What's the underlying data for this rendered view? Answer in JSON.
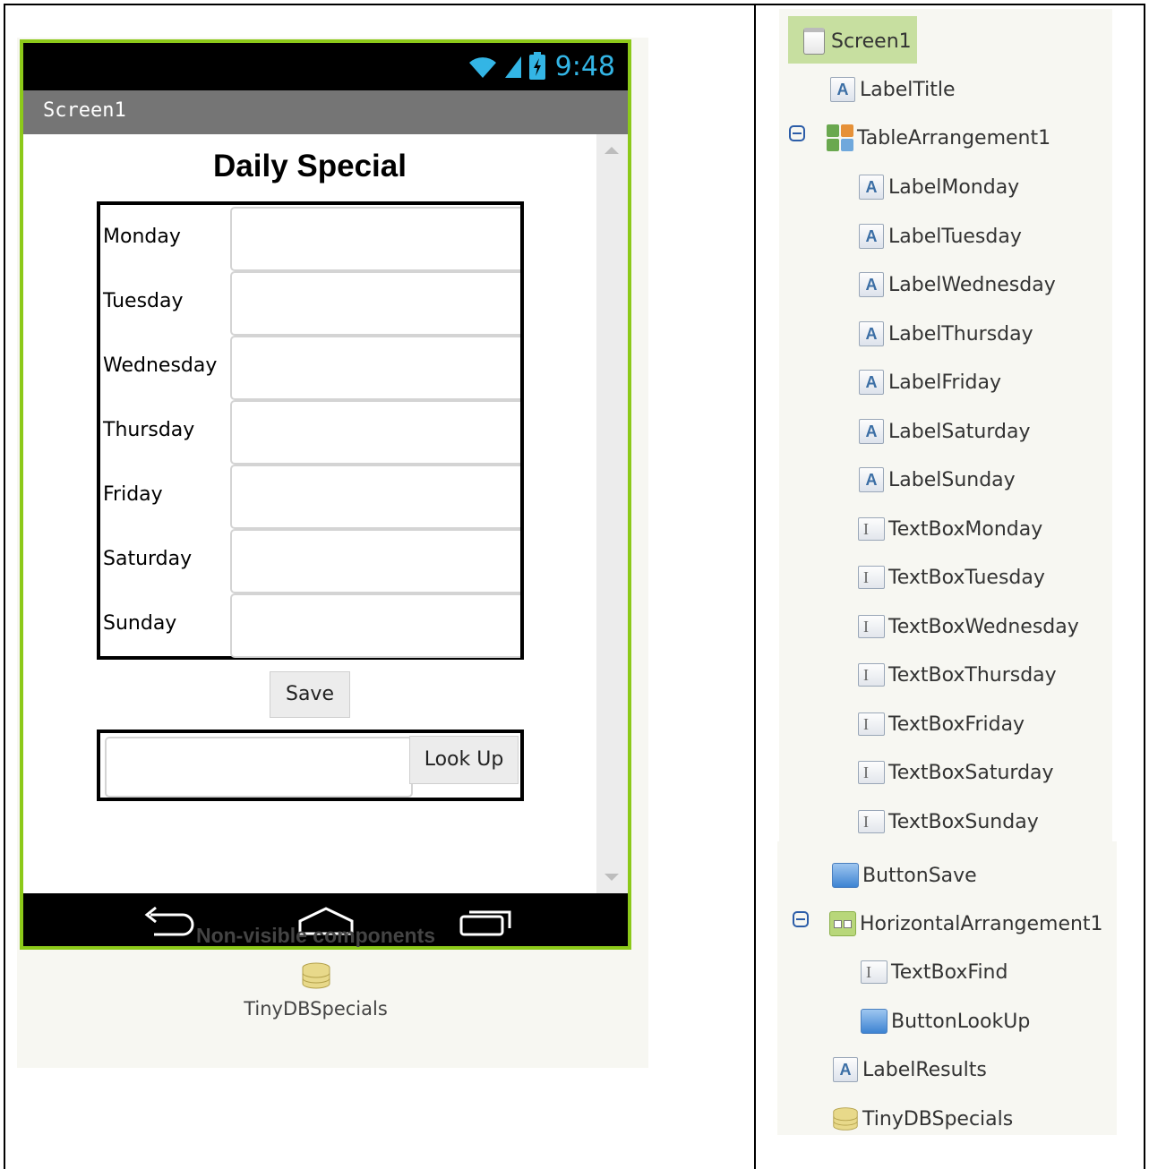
{
  "viewer": {
    "status_time": "9:48",
    "screen_title": "Screen1",
    "app_title": "Daily Special",
    "days": [
      "Monday",
      "Tuesday",
      "Wednesday",
      "Thursday",
      "Friday",
      "Saturday",
      "Sunday"
    ],
    "save_label": "Save",
    "lookup_label": "Look Up",
    "nonvisible_title": "Non-visible components",
    "nonvisible_item": "TinyDBSpecials"
  },
  "tree": {
    "screen": "Screen1",
    "items": [
      "LabelTitle",
      "TableArrangement1",
      "LabelMonday",
      "LabelTuesday",
      "LabelWednesday",
      "LabelThursday",
      "LabelFriday",
      "LabelSaturday",
      "LabelSunday",
      "TextBoxMonday",
      "TextBoxTuesday",
      "TextBoxWednesday",
      "TextBoxThursday",
      "TextBoxFriday",
      "TextBoxSaturday",
      "TextBoxSunday",
      "ButtonSave",
      "HorizontalArrangement1",
      "TextBoxFind",
      "ButtonLookUp",
      "LabelResults",
      "TinyDBSpecials"
    ]
  },
  "colors": {
    "phone_border": "#8cc919",
    "status_blue": "#33b5e5",
    "selected_bg": "#c7dfa0",
    "panel_bg": "#f7f7f2"
  }
}
